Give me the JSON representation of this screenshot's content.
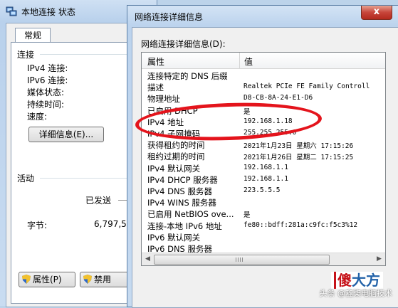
{
  "back_window": {
    "title": "本地连接 状态",
    "tab": "常规",
    "connection": {
      "group": "连接",
      "rows": [
        "IPv4 连接:",
        "IPv6 连接:",
        "媒体状态:",
        "持续时间:",
        "速度:"
      ]
    },
    "details_button": "详细信息(E)...",
    "activity": {
      "group": "活动",
      "sent_label": "已发送",
      "bytes_label": "字节:",
      "bytes_value": "6,797,5"
    },
    "properties_button": "属性(P)",
    "disable_button": "禁用"
  },
  "dialog": {
    "title": "网络连接详细信息",
    "close_glyph": "x",
    "label": "网络连接详细信息(D):",
    "col_property": "属性",
    "col_value": "值",
    "rows": [
      {
        "k": "连接特定的 DNS 后缀",
        "v": ""
      },
      {
        "k": "描述",
        "v": "Realtek PCIe FE Family Controll"
      },
      {
        "k": "物理地址",
        "v": "D8-CB-8A-24-E1-D6"
      },
      {
        "k": "已启用 DHCP",
        "v": "是"
      },
      {
        "k": "IPv4 地址",
        "v": "192.168.1.18"
      },
      {
        "k": "IPv4 子网掩码",
        "v": "255.255.255.0"
      },
      {
        "k": "获得租约的时间",
        "v": "2021年1月23日 星期六 17:15:26"
      },
      {
        "k": "租约过期的时间",
        "v": "2021年1月26日 星期二 17:15:25"
      },
      {
        "k": "IPv4 默认网关",
        "v": "192.168.1.1"
      },
      {
        "k": "IPv4 DHCP 服务器",
        "v": "192.168.1.1"
      },
      {
        "k": "IPv4 DNS 服务器",
        "v": "223.5.5.5"
      },
      {
        "k": "IPv4 WINS 服务器",
        "v": ""
      },
      {
        "k": "已启用 NetBIOS ove...",
        "v": "是"
      },
      {
        "k": "连接-本地 IPv6 地址",
        "v": "fe80::bdff:281a:c9fc:f5c3%12"
      },
      {
        "k": "IPv6 默认网关",
        "v": ""
      },
      {
        "k": "IPv6 DNS 服务器",
        "v": ""
      }
    ]
  },
  "watermark": {
    "brand_first": "傻",
    "brand_rest": "大方",
    "credit": "头条 @鑫柒电脑技术"
  },
  "colors": {
    "highlight_ellipse": "#e4141c",
    "close_button": "#c7453a",
    "window_frame": "#bcd3ed"
  }
}
